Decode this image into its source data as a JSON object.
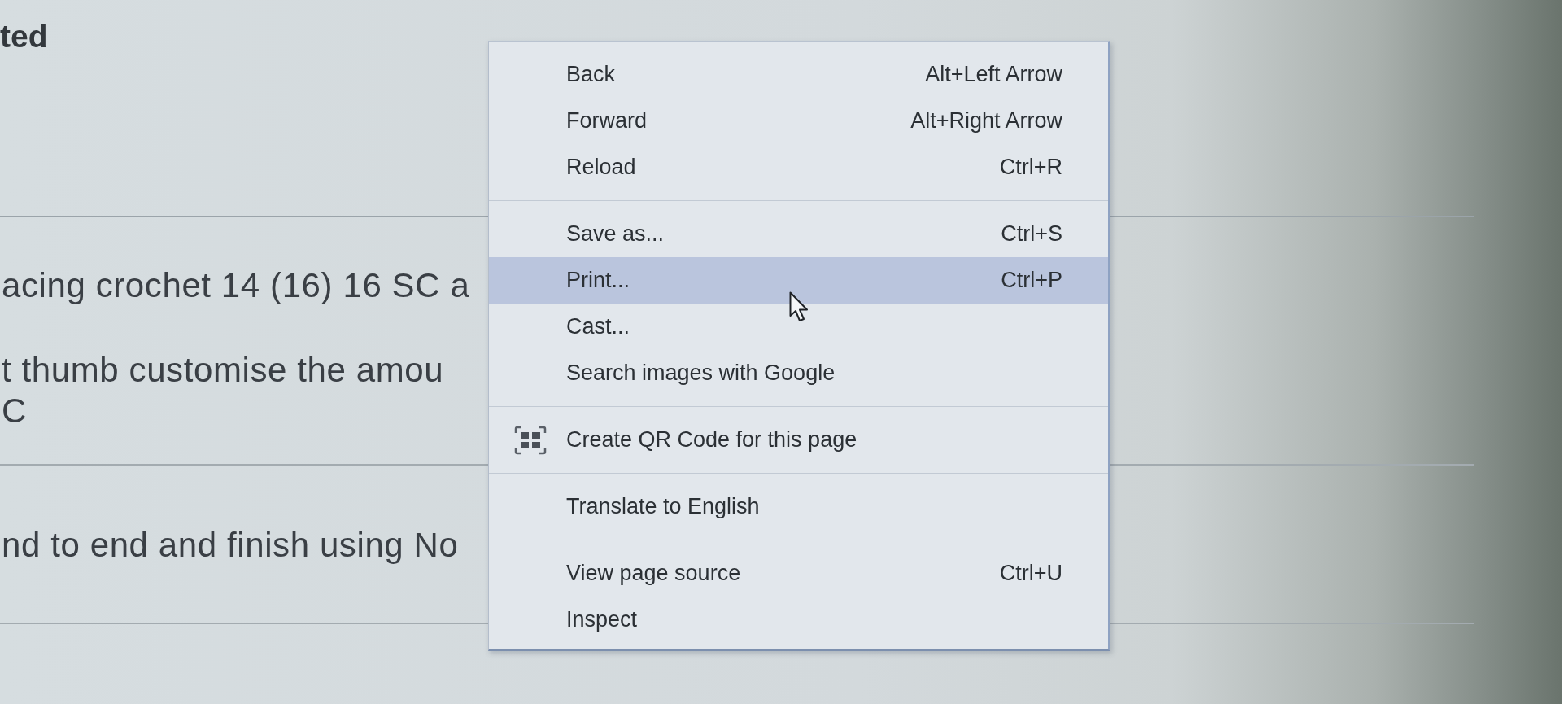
{
  "page": {
    "heading": "ted",
    "sections": [
      {
        "paragraphs": [
          {
            "lines": [
              "acing crochet 14 (16) 16 SC a"
            ]
          },
          {
            "lines": [
              "t thumb customise the amou",
              "C"
            ]
          }
        ]
      },
      {
        "paragraphs": [
          {
            "lines": [
              "nd to end and finish using No"
            ]
          }
        ]
      }
    ]
  },
  "context_menu": {
    "groups": [
      {
        "items": [
          {
            "kind": "plain",
            "label": "Back",
            "shortcut": "Alt+Left Arrow",
            "highlighted": false
          },
          {
            "kind": "plain",
            "label": "Forward",
            "shortcut": "Alt+Right Arrow",
            "highlighted": false
          },
          {
            "kind": "plain",
            "label": "Reload",
            "shortcut": "Ctrl+R",
            "highlighted": false
          }
        ]
      },
      {
        "items": [
          {
            "kind": "plain",
            "label": "Save as...",
            "shortcut": "Ctrl+S",
            "highlighted": false
          },
          {
            "kind": "plain",
            "label": "Print...",
            "shortcut": "Ctrl+P",
            "highlighted": true
          },
          {
            "kind": "plain",
            "label": "Cast...",
            "highlighted": false
          },
          {
            "kind": "plain",
            "label": "Search images with Google",
            "highlighted": false
          }
        ]
      },
      {
        "items": [
          {
            "kind": "qr",
            "label": "Create QR Code for this page",
            "highlighted": false
          }
        ]
      },
      {
        "items": [
          {
            "kind": "plain",
            "label": "Translate to English",
            "highlighted": false
          }
        ]
      },
      {
        "items": [
          {
            "kind": "plain",
            "label": "View page source",
            "shortcut": "Ctrl+U",
            "highlighted": false
          },
          {
            "kind": "plain",
            "label": "Inspect",
            "highlighted": false
          }
        ]
      }
    ]
  }
}
